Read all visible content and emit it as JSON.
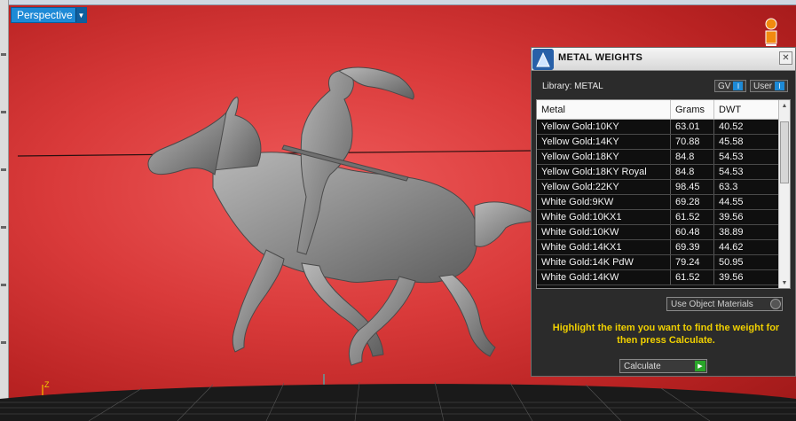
{
  "viewport": {
    "view_mode": "Perspective",
    "axis_z": "Z",
    "axis_y": "Y"
  },
  "panel": {
    "title": "METAL WEIGHTS",
    "close": "✕",
    "library_label": "Library: METAL",
    "toggle_gv": "GV",
    "toggle_user": "User",
    "toggle_icon": "I",
    "columns": [
      "Metal",
      "Grams",
      "DWT"
    ],
    "rows": [
      [
        "Yellow Gold:10KY",
        "63.01",
        "40.52"
      ],
      [
        "Yellow Gold:14KY",
        "70.88",
        "45.58"
      ],
      [
        "Yellow Gold:18KY",
        "84.8",
        "54.53"
      ],
      [
        "Yellow Gold:18KY Royal",
        "84.8",
        "54.53"
      ],
      [
        "Yellow Gold:22KY",
        "98.45",
        "63.3"
      ],
      [
        "White Gold:9KW",
        "69.28",
        "44.55"
      ],
      [
        "White Gold:10KX1",
        "61.52",
        "39.56"
      ],
      [
        "White Gold:10KW",
        "60.48",
        "38.89"
      ],
      [
        "White Gold:14KX1",
        "69.39",
        "44.62"
      ],
      [
        "White Gold:14K PdW",
        "79.24",
        "50.95"
      ],
      [
        "White Gold:14KW",
        "61.52",
        "39.56"
      ]
    ],
    "use_object_materials": "Use Object Materials",
    "hint": "Highlight the item you want to find the weight for then press Calculate.",
    "calculate": "Calculate"
  },
  "colors": {
    "background_red": "#d93a3a",
    "panel_bg": "#2b2b2b",
    "hint_yellow": "#f0d000",
    "accent_blue": "#1e8ad6",
    "go_green": "#2aa52a"
  },
  "icons": [
    "dropdown-arrow-icon",
    "app-logo-icon",
    "close-icon",
    "scroll-up-icon",
    "scroll-down-icon",
    "play-arrow-icon",
    "gizmo-icon"
  ]
}
